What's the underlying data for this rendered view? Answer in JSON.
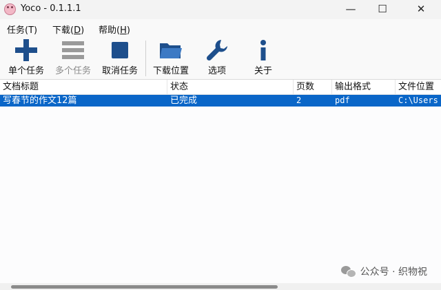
{
  "window": {
    "title": "Yoco - 0.1.1.1",
    "minimize_glyph": "—",
    "maximize_glyph": "☐",
    "close_glyph": "✕"
  },
  "menu": {
    "task": "任务(T)",
    "download_prefix": "下载(",
    "download_key": "D",
    "download_suffix": ")",
    "help_prefix": "帮助(",
    "help_key": "H",
    "help_suffix": ")"
  },
  "toolbar": {
    "single_task": "单个任务",
    "multi_task": "多个任务",
    "cancel_task": "取消任务",
    "download_location": "下载位置",
    "options": "选项",
    "about": "关于"
  },
  "table": {
    "columns": [
      "文档标题",
      "状态",
      "页数",
      "输出格式",
      "文件位置"
    ],
    "rows": [
      {
        "title": "写春节的作文12篇",
        "status": "已完成",
        "pages": "2",
        "format": "pdf",
        "location": "C:\\Users"
      }
    ]
  },
  "watermark": "公众号 · 织物祝",
  "colors": {
    "selection": "#0a66c8",
    "icon_blue": "#1e4f8c",
    "icon_disabled": "#9a9a9a"
  },
  "icons": {
    "single_task": "plus-icon",
    "multi_task": "list-icon",
    "cancel_task": "stop-icon",
    "download_location": "folder-icon",
    "options": "wrench-icon",
    "about": "info-icon"
  }
}
